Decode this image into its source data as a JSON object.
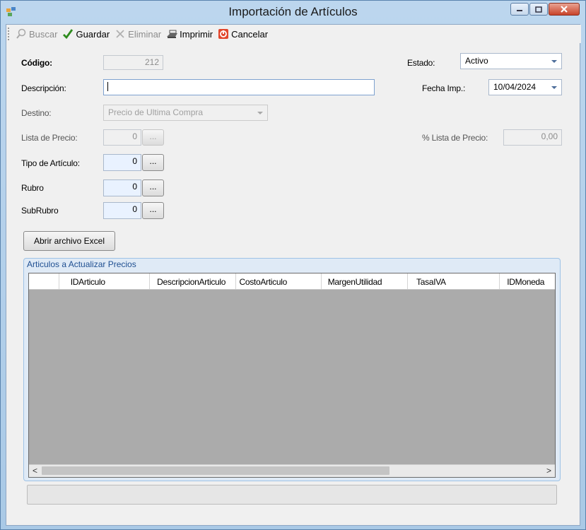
{
  "window": {
    "title": "Importación de Artículos"
  },
  "toolbar": {
    "buscar": "Buscar",
    "guardar": "Guardar",
    "eliminar": "Eliminar",
    "imprimir": "Imprimir",
    "cancelar": "Cancelar"
  },
  "form": {
    "codigo_label": "Código:",
    "codigo_value": "212",
    "estado_label": "Estado:",
    "estado_value": "Activo",
    "descripcion_label": "Descripción:",
    "descripcion_value": "",
    "fecha_label": "Fecha Imp.:",
    "fecha_value": "10/04/2024",
    "destino_label": "Destino:",
    "destino_value": "Precio de Ultima Compra",
    "lista_label": "Lista de Precio:",
    "lista_value": "0",
    "pct_lista_label": "% Lista de Precio:",
    "pct_lista_value": "0,00",
    "tipo_label": "Tipo de Artículo:",
    "tipo_value": "0",
    "rubro_label": "Rubro",
    "rubro_value": "0",
    "subrubro_label": "SubRubro",
    "subrubro_value": "0",
    "ellipsis": "...",
    "abrir_excel": "Abrir archivo Excel"
  },
  "group": {
    "title": "Articulos a Actualizar Precios",
    "columns": [
      "",
      "IDArticulo",
      "DescripcionArticulo",
      "CostoArticulo",
      "MargenUtilidad",
      "TasaIVA",
      "IDMoneda"
    ]
  },
  "colors": {
    "accent": "#1f4f91",
    "grid_bg": "#ababab"
  },
  "icons": [
    "app-icon",
    "search-icon",
    "check-icon",
    "delete-icon",
    "print-icon",
    "cancel-icon"
  ]
}
